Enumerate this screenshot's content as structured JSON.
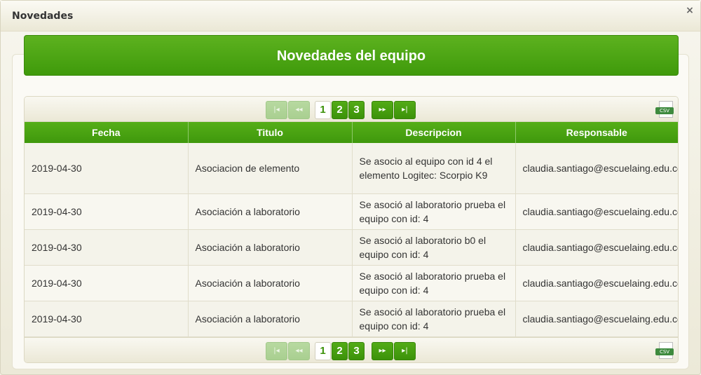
{
  "dialog": {
    "title": "Novedades",
    "close_glyph": "×"
  },
  "header": {
    "title": "Novedades del equipo"
  },
  "paginator": {
    "first_glyph": "|◂",
    "prev_glyph": "◂◂",
    "next_glyph": "▸▸",
    "last_glyph": "▸|",
    "pages": [
      "1",
      "2",
      "3"
    ],
    "current_page": "1",
    "export_label": "CSV"
  },
  "table": {
    "columns": [
      "Fecha",
      "Titulo",
      "Descripcion",
      "Responsable"
    ],
    "rows": [
      {
        "fecha": "2019-04-30",
        "titulo": "Asociacion de elemento",
        "descripcion": "Se asocio al equipo con id 4 el elemento Logitec: Scorpio K9",
        "responsable": "claudia.santiago@escuelaing.edu.co"
      },
      {
        "fecha": "2019-04-30",
        "titulo": "Asociación a laboratorio",
        "descripcion": "Se asoció al laboratorio prueba el equipo con id: 4",
        "responsable": "claudia.santiago@escuelaing.edu.co"
      },
      {
        "fecha": "2019-04-30",
        "titulo": "Asociación a laboratorio",
        "descripcion": "Se asoció al laboratorio b0 el equipo con id: 4",
        "responsable": "claudia.santiago@escuelaing.edu.co"
      },
      {
        "fecha": "2019-04-30",
        "titulo": "Asociación a laboratorio",
        "descripcion": "Se asoció al laboratorio prueba el equipo con id: 4",
        "responsable": "claudia.santiago@escuelaing.edu.co"
      },
      {
        "fecha": "2019-04-30",
        "titulo": "Asociación a laboratorio",
        "descripcion": "Se asoció al laboratorio prueba el equipo con id: 4",
        "responsable": "claudia.santiago@escuelaing.edu.co"
      }
    ]
  },
  "colors": {
    "accent": "#4ca414",
    "background": "#f3f1e6"
  }
}
